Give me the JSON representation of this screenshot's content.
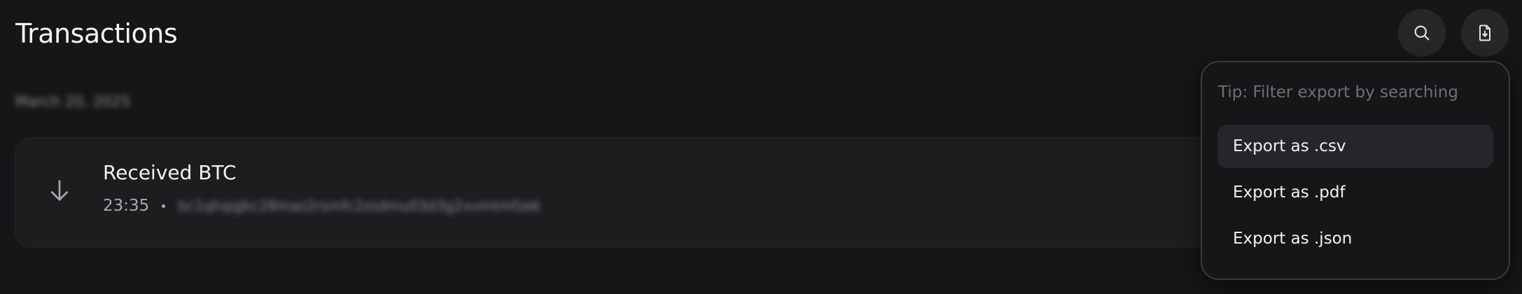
{
  "header": {
    "title": "Transactions",
    "search_icon": "search-icon",
    "export_icon": "file-download-icon"
  },
  "transactions": {
    "date_header": "March 20, 2025",
    "items": [
      {
        "direction_icon": "arrow-down-icon",
        "title": "Received BTC",
        "time": "23:35",
        "address": "bc1qhqqjkc28maz2rsmfc2zsdmu03d3g2xvmtmfzek"
      }
    ]
  },
  "export_menu": {
    "tip": "Tip: Filter export by searching",
    "items": [
      {
        "label": "Export as .csv"
      },
      {
        "label": "Export as .pdf"
      },
      {
        "label": "Export as .json"
      }
    ]
  },
  "colors": {
    "background": "#161618",
    "card": "#1d1d20",
    "icon_button": "#27272a",
    "menu_highlight": "#26262a",
    "text_primary": "#f2f2f2",
    "text_muted": "#6f6f74"
  }
}
